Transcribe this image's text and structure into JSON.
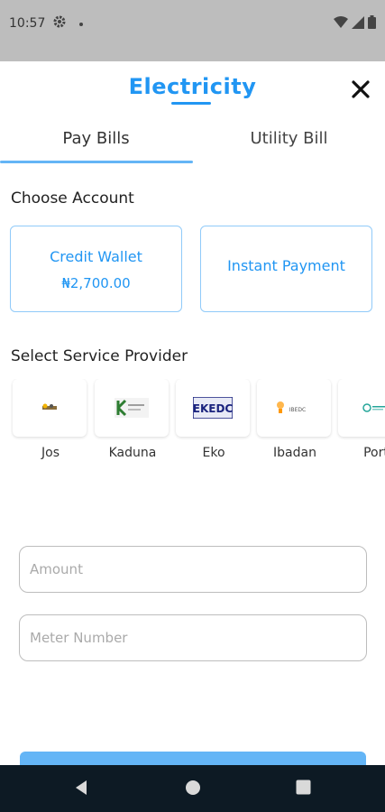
{
  "status_bar": {
    "time": "10:57"
  },
  "header": {
    "title": "Electricity"
  },
  "tabs": [
    {
      "label": "Pay Bills",
      "active": true
    },
    {
      "label": "Utility Bill",
      "active": false
    }
  ],
  "choose_account": {
    "title": "Choose Account",
    "cards": [
      {
        "label": "Credit Wallet",
        "amount": "₦2,700.00"
      },
      {
        "label": "Instant Payment"
      }
    ]
  },
  "service_provider": {
    "title": "Select Service Provider",
    "providers": [
      {
        "name": "Jos"
      },
      {
        "name": "Kaduna"
      },
      {
        "name": "Eko",
        "logo_text": "EKEDC"
      },
      {
        "name": "Ibadan",
        "logo_text": "IBEDC"
      },
      {
        "name": "Port"
      }
    ]
  },
  "form": {
    "amount_placeholder": "Amount",
    "meter_placeholder": "Meter Number"
  },
  "colors": {
    "accent": "#2196f3",
    "accent_light": "#64b5f6",
    "card_border": "#90caf9"
  }
}
